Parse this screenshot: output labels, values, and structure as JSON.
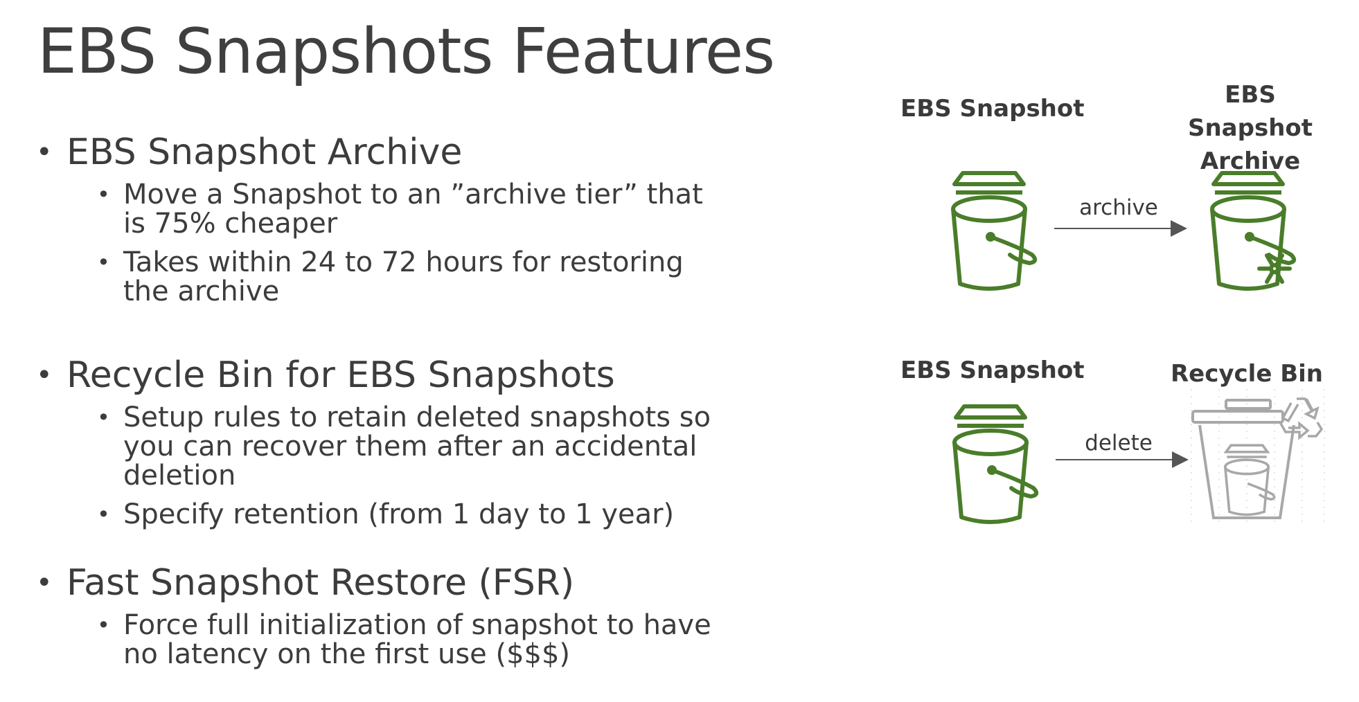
{
  "slide": {
    "title": "EBS Snapshots Features"
  },
  "sections": [
    {
      "heading": "EBS Snapshot Archive",
      "bullets": [
        "Move a Snapshot to an ”archive tier” that is 75% cheaper",
        "Takes within 24 to 72 hours for restoring the archive"
      ]
    },
    {
      "heading": "Recycle Bin for EBS Snapshots",
      "bullets": [
        "Setup rules to retain deleted snapshots so you can recover them after an accidental deletion",
        "Specify retention (from 1 day to 1 year)"
      ]
    },
    {
      "heading": "Fast Snapshot Restore (FSR)",
      "bullets": [
        "Force full initialization of snapshot to have no latency on the first use ($$$)"
      ]
    }
  ],
  "diagram": {
    "archive_flow": {
      "source_label": "EBS Snapshot",
      "target_label": "EBS Snapshot Archive",
      "arrow_label": "archive",
      "source_icon": "bucket-icon",
      "target_icon": "bucket-snowflake-icon"
    },
    "delete_flow": {
      "source_label": "EBS Snapshot",
      "target_label": "Recycle Bin",
      "arrow_label": "delete",
      "source_icon": "bucket-icon",
      "target_icon": "recycle-bin-icon"
    },
    "colors": {
      "icon_green": "#4a7d2a",
      "icon_gray": "#a8a8a8",
      "arrow": "#555555",
      "text": "#3c3c3c"
    }
  }
}
